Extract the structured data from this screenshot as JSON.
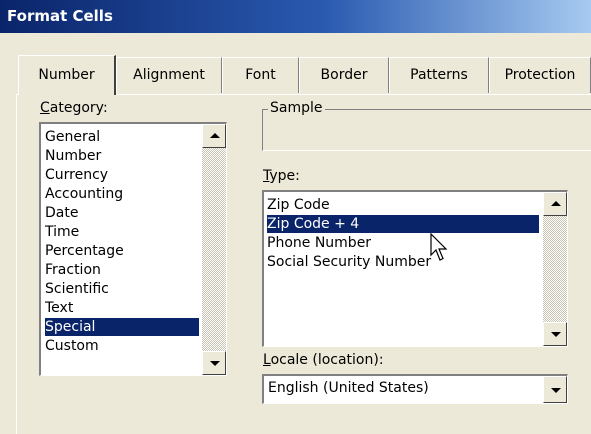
{
  "window": {
    "title": "Format Cells"
  },
  "tabs": [
    {
      "label": "Number",
      "active": true
    },
    {
      "label": "Alignment"
    },
    {
      "label": "Font"
    },
    {
      "label": "Border"
    },
    {
      "label": "Patterns"
    },
    {
      "label": "Protection"
    }
  ],
  "category": {
    "label_mnemonic": "C",
    "label_rest": "ategory:",
    "items": [
      "General",
      "Number",
      "Currency",
      "Accounting",
      "Date",
      "Time",
      "Percentage",
      "Fraction",
      "Scientific",
      "Text",
      "Special",
      "Custom"
    ],
    "selected": "Special"
  },
  "sample": {
    "label": "Sample",
    "value": ""
  },
  "type": {
    "label_mnemonic": "T",
    "label_rest": "ype:",
    "items": [
      "Zip Code",
      "Zip Code + 4",
      "Phone Number",
      "Social Security Number"
    ],
    "selected": "Zip Code + 4"
  },
  "locale": {
    "label_mnemonic": "L",
    "label_rest": "ocale (location):",
    "value": "English (United States)"
  },
  "colors": {
    "selection": "#0a246a",
    "dialog_bg": "#ece9d8"
  },
  "icons": {
    "cursor": "arrow-cursor-icon"
  }
}
